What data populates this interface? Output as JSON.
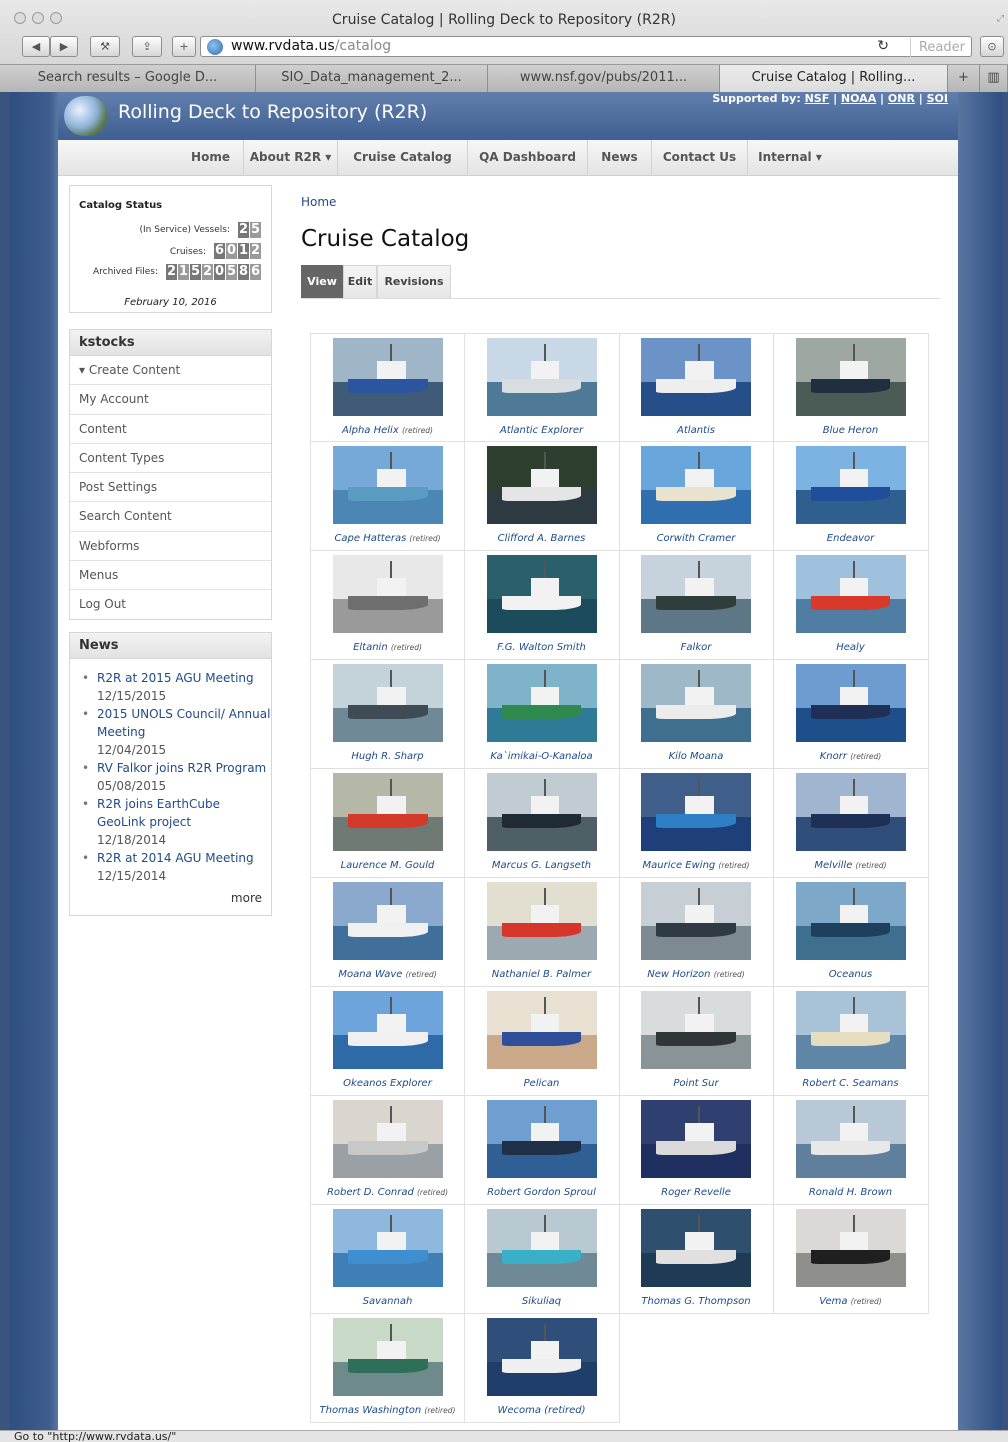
{
  "window": {
    "title": "Cruise Catalog | Rolling Deck to Repository (R2R)"
  },
  "toolbar": {
    "url_host": "www.rvdata.us",
    "url_path": "/catalog",
    "reader": "Reader"
  },
  "tabs": [
    {
      "label": "Search results – Google D..."
    },
    {
      "label": "SIO_Data_management_2..."
    },
    {
      "label": "www.nsf.gov/pubs/2011..."
    },
    {
      "label": "Cruise Catalog | Rolling..."
    }
  ],
  "header": {
    "site_name": "Rolling Deck to Repository (R2R)",
    "supported_by": "Supported by:",
    "sponsors": [
      "NSF",
      "NOAA",
      "ONR",
      "SOI"
    ]
  },
  "nav": {
    "items": [
      "Home",
      "About R2R ▾",
      "Cruise Catalog",
      "QA Dashboard",
      "News",
      "Contact Us",
      "Internal ▾"
    ]
  },
  "catalog_status": {
    "title": "Catalog Status",
    "vessels_label": "(In Service) Vessels:",
    "vessels": "25",
    "cruises_label": "Cruises:",
    "cruises": "6012",
    "files_label": "Archived Files:",
    "files": "21520586",
    "date": "February 10, 2016"
  },
  "user": {
    "name": "kstocks",
    "menu": [
      "▾ Create Content",
      "My Account",
      "Content",
      "Content Types",
      "Post Settings",
      "Search Content",
      "Webforms",
      "Menus",
      "Log Out"
    ]
  },
  "news": {
    "title": "News",
    "items": [
      {
        "text": "R2R at 2015 AGU Meeting",
        "date": "12/15/2015"
      },
      {
        "text": "2015 UNOLS Council/ Annual Meeting",
        "date": "12/04/2015"
      },
      {
        "text": "RV Falkor joins R2R Program",
        "date": "05/08/2015"
      },
      {
        "text": "R2R joins EarthCube GeoLink project",
        "date": "12/18/2014"
      },
      {
        "text": "R2R at 2014 AGU Meeting",
        "date": "12/15/2014"
      }
    ],
    "more": "more"
  },
  "main": {
    "breadcrumb": "Home",
    "title": "Cruise Catalog",
    "tabs": [
      "View",
      "Edit",
      "Revisions"
    ]
  },
  "vessels": [
    {
      "name": "Alpha Helix",
      "retired": "(retired)",
      "colors": [
        "#9fb6c9",
        "#3f5b78",
        "#2b55a0"
      ]
    },
    {
      "name": "Atlantic Explorer",
      "retired": "",
      "colors": [
        "#c9d8e6",
        "#4f7a97",
        "#d8dde2"
      ]
    },
    {
      "name": "Atlantis",
      "retired": "",
      "colors": [
        "#6b93c7",
        "#264f8a",
        "#eeeeee"
      ]
    },
    {
      "name": "Blue Heron",
      "retired": "",
      "colors": [
        "#9ea7a2",
        "#4a5c55",
        "#1f2f3f"
      ]
    },
    {
      "name": "Cape Hatteras",
      "retired": "(retired)",
      "colors": [
        "#76a9d8",
        "#4c86b5",
        "#5a9bc2"
      ]
    },
    {
      "name": "Clifford A. Barnes",
      "retired": "",
      "colors": [
        "#2f3f2f",
        "#2d3a42",
        "#e5e5e5"
      ]
    },
    {
      "name": "Corwith Cramer",
      "retired": "",
      "colors": [
        "#69a6dc",
        "#2f6fb0",
        "#e8e2cf"
      ]
    },
    {
      "name": "Endeavor",
      "retired": "",
      "colors": [
        "#7db3e2",
        "#2e5f8e",
        "#1f4f9a"
      ]
    },
    {
      "name": "Eltanin",
      "retired": "(retired)",
      "colors": [
        "#e8e8e8",
        "#9a9a9a",
        "#6e6e6e"
      ]
    },
    {
      "name": "F.G. Walton Smith",
      "retired": "",
      "colors": [
        "#2a5f6c",
        "#1c4c5c",
        "#f2f2f2"
      ]
    },
    {
      "name": "Falkor",
      "retired": "",
      "colors": [
        "#c6d3dc",
        "#5d7786",
        "#2f3e3c"
      ]
    },
    {
      "name": "Healy",
      "retired": "",
      "colors": [
        "#9fc1dd",
        "#4f7ea2",
        "#d8392b"
      ]
    },
    {
      "name": "Hugh R. Sharp",
      "retired": "",
      "colors": [
        "#c4d2da",
        "#6f8a96",
        "#3f4b55"
      ]
    },
    {
      "name": "Ka`imikai-O-Kanaloa",
      "retired": "",
      "colors": [
        "#7fb3c9",
        "#2f7a96",
        "#2f8a4f"
      ]
    },
    {
      "name": "Kilo Moana",
      "retired": "",
      "colors": [
        "#9fb8c8",
        "#3f6f8f",
        "#ececec"
      ]
    },
    {
      "name": "Knorr",
      "retired": "(retired)",
      "colors": [
        "#6d9cd0",
        "#1f4f8a",
        "#1f2f55"
      ]
    },
    {
      "name": "Laurence M. Gould",
      "retired": "",
      "colors": [
        "#b5b7a9",
        "#6f7a75",
        "#d33a2a"
      ]
    },
    {
      "name": "Marcus G. Langseth",
      "retired": "",
      "colors": [
        "#c1ccd2",
        "#4f5f66",
        "#1f2a35"
      ]
    },
    {
      "name": "Maurice Ewing",
      "retired": "(retired)",
      "colors": [
        "#3f5f8a",
        "#1f3f7a",
        "#2f7fc4"
      ]
    },
    {
      "name": "Melville",
      "retired": "(retired)",
      "colors": [
        "#9fb5d0",
        "#2f4f7a",
        "#1f2f55"
      ]
    },
    {
      "name": "Moana Wave",
      "retired": "(retired)",
      "colors": [
        "#8aa9cc",
        "#3f6f9a",
        "#f0f0f0"
      ]
    },
    {
      "name": "Nathaniel B. Palmer",
      "retired": "",
      "colors": [
        "#e2ded0",
        "#9da9b0",
        "#d6352a"
      ]
    },
    {
      "name": "New Horizon",
      "retired": "(retired)",
      "colors": [
        "#c8cfd4",
        "#7d8a91",
        "#2f3a45"
      ]
    },
    {
      "name": "Oceanus",
      "retired": "",
      "colors": [
        "#7ea8c9",
        "#3f6f8f",
        "#1f3f5f"
      ]
    },
    {
      "name": "Okeanos Explorer",
      "retired": "",
      "colors": [
        "#6ea4dc",
        "#2f6aa8",
        "#f0f0f0"
      ]
    },
    {
      "name": "Pelican",
      "retired": "",
      "colors": [
        "#e8e0d0",
        "#c9a98a",
        "#2f4f9a"
      ]
    },
    {
      "name": "Point Sur",
      "retired": "",
      "colors": [
        "#d9dcdc",
        "#8a9497",
        "#2f3538"
      ]
    },
    {
      "name": "Robert C. Seamans",
      "retired": "",
      "colors": [
        "#a8c2d8",
        "#5f86a6",
        "#e6dcc0"
      ]
    },
    {
      "name": "Robert D. Conrad",
      "retired": "(retired)",
      "colors": [
        "#dad6cf",
        "#9aa0a3",
        "#c8c8c8"
      ]
    },
    {
      "name": "Robert Gordon Sproul",
      "retired": "",
      "colors": [
        "#6f9fd0",
        "#2f5f95",
        "#1f2f45"
      ]
    },
    {
      "name": "Roger Revelle",
      "retired": "",
      "colors": [
        "#2f3f6f",
        "#1f2f5f",
        "#dadada"
      ]
    },
    {
      "name": "Ronald H. Brown",
      "retired": "",
      "colors": [
        "#b8c8d6",
        "#5f7f9c",
        "#e8e8e8"
      ]
    },
    {
      "name": "Savannah",
      "retired": "",
      "colors": [
        "#8fb8df",
        "#3f7fb5",
        "#3f8fd0"
      ]
    },
    {
      "name": "Sikuliaq",
      "retired": "",
      "colors": [
        "#b9c9d2",
        "#6f8a96",
        "#3ab0c8"
      ]
    },
    {
      "name": "Thomas G. Thompson",
      "retired": "",
      "colors": [
        "#2f4f6f",
        "#1f3a55",
        "#e0e0e0"
      ]
    },
    {
      "name": "Vema",
      "retired": "(retired)",
      "colors": [
        "#dad9d5",
        "#8f908b",
        "#1f1f1f"
      ]
    },
    {
      "name": "Thomas Washington",
      "retired": "(retired)",
      "colors": [
        "#c9d9c8",
        "#6f8a8a",
        "#2f6f5a"
      ]
    },
    {
      "name": "Wecoma (retired)",
      "retired": "",
      "colors": [
        "#2f4f7a",
        "#1f3f6a",
        "#efefef"
      ]
    }
  ],
  "statusbar": {
    "text": "Go to \"http://www.rvdata.us/\""
  }
}
